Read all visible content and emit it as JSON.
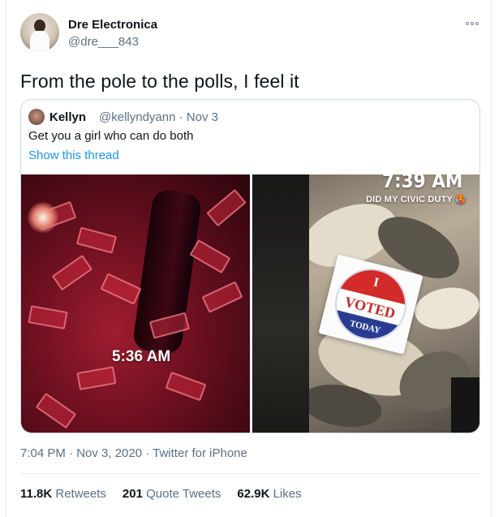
{
  "author": {
    "display_name": "Dre Electronica",
    "handle": "@dre___843"
  },
  "tweet_text": "From the pole to the polls, I feel it",
  "quoted": {
    "name": "Kellyn",
    "meta": "@kellyndyann · Nov 3",
    "text": "Get you a girl who can do both",
    "show_thread": "Show this thread",
    "media_left": {
      "overlay_time": "5:36 AM"
    },
    "media_right": {
      "overlay_time": "7:39 AM",
      "overlay_caption": "DID MY CIVIC DUTY 🥵",
      "sticker": {
        "line1": "I",
        "line2": "VOTED",
        "line3": "TODAY"
      }
    }
  },
  "timestamp": "7:04 PM · Nov 3, 2020 · Twitter for iPhone",
  "stats": {
    "retweets_count": "11.8K",
    "retweets_label": "Retweets",
    "quotes_count": "201",
    "quotes_label": "Quote Tweets",
    "likes_count": "62.9K",
    "likes_label": "Likes"
  },
  "colors": {
    "link": "#1b95e0",
    "secondary_text": "#5b7083",
    "border": "#cfd9de"
  }
}
